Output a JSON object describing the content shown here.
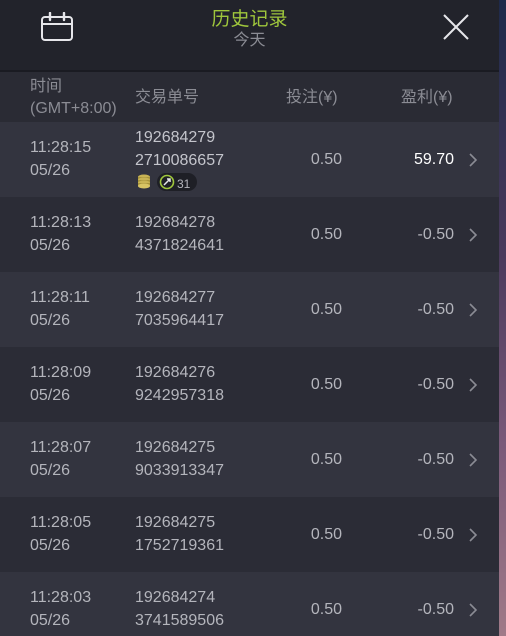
{
  "header": {
    "title": "历史记录",
    "subtitle": "今天"
  },
  "columns": {
    "time_line1": "时间",
    "time_line2": "(GMT+8:00)",
    "order": "交易单号",
    "bet": "投注(¥)",
    "profit": "盈利(¥)"
  },
  "colors": {
    "title": "#9fc63c",
    "win": "#ffffff",
    "text": "#b4b5bc"
  },
  "rows": [
    {
      "time": "11:28:15",
      "date": "05/26",
      "order_line1": "192684279",
      "order_line2": "2710086657",
      "bet": "0.50",
      "profit": "59.70",
      "badge_count": "31"
    },
    {
      "time": "11:28:13",
      "date": "05/26",
      "order_line1": "192684278",
      "order_line2": "4371824641",
      "bet": "0.50",
      "profit": "-0.50"
    },
    {
      "time": "11:28:11",
      "date": "05/26",
      "order_line1": "192684277",
      "order_line2": "7035964417",
      "bet": "0.50",
      "profit": "-0.50"
    },
    {
      "time": "11:28:09",
      "date": "05/26",
      "order_line1": "192684276",
      "order_line2": "9242957318",
      "bet": "0.50",
      "profit": "-0.50"
    },
    {
      "time": "11:28:07",
      "date": "05/26",
      "order_line1": "192684275",
      "order_line2": "9033913347",
      "bet": "0.50",
      "profit": "-0.50"
    },
    {
      "time": "11:28:05",
      "date": "05/26",
      "order_line1": "192684275",
      "order_line2": "1752719361",
      "bet": "0.50",
      "profit": "-0.50"
    },
    {
      "time": "11:28:03",
      "date": "05/26",
      "order_line1": "192684274",
      "order_line2": "3741589506",
      "bet": "0.50",
      "profit": "-0.50"
    }
  ]
}
